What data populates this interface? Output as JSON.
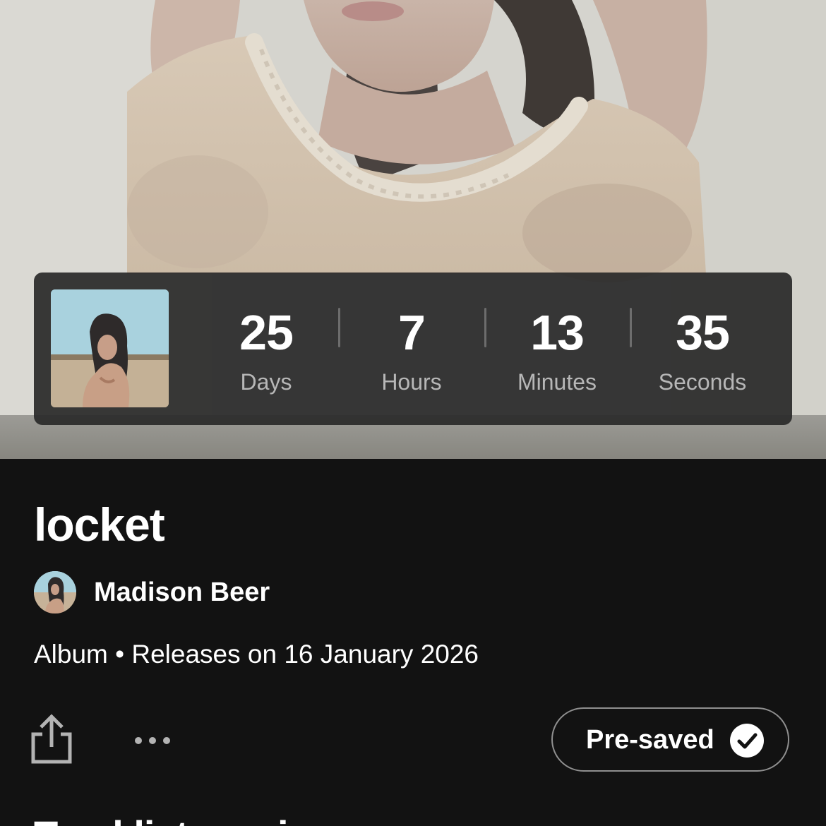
{
  "hero": {
    "image_desc_icon": "album-hero-photo"
  },
  "countdown": {
    "days": {
      "value": "25",
      "label": "Days"
    },
    "hours": {
      "value": "7",
      "label": "Hours"
    },
    "minutes": {
      "value": "13",
      "label": "Minutes"
    },
    "seconds": {
      "value": "35",
      "label": "Seconds"
    }
  },
  "album": {
    "title": "locket",
    "artist": "Madison Beer",
    "meta": "Album • Releases on 16 January 2026"
  },
  "actions": {
    "share_icon": "share-icon",
    "more_icon": "more-icon",
    "presave_label": "Pre-saved",
    "check_icon": "check-circle-icon"
  },
  "section": {
    "heading": "Tracklist coming soon"
  },
  "colors": {
    "background": "#121212",
    "card": "#2a2a2a",
    "muted_text": "#b7b7b7",
    "button_border": "#8f8f8f"
  }
}
